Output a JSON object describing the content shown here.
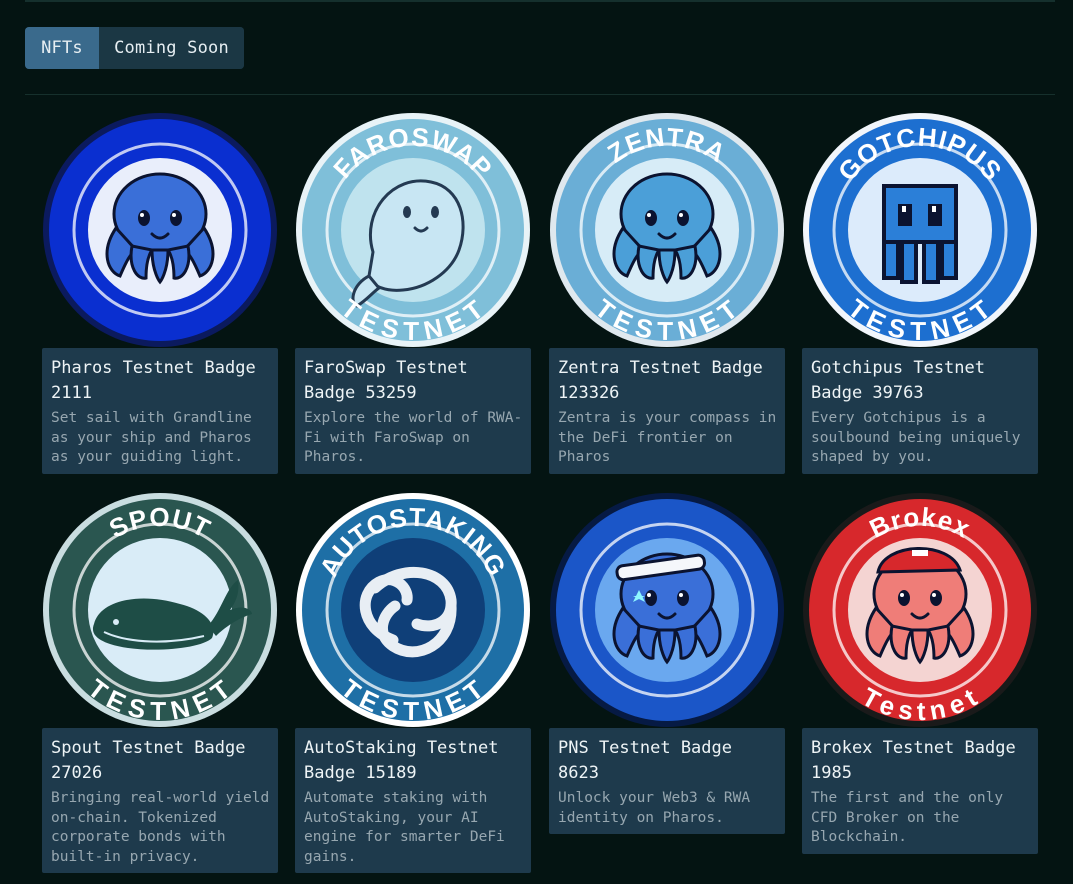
{
  "tabs": [
    {
      "label": "NFTs",
      "active": true
    },
    {
      "label": "Coming Soon",
      "active": false
    }
  ],
  "nfts": [
    {
      "title": "Pharos Testnet Badge 2111",
      "description": "Set sail with Grandline as your ship and Pharos as your guiding light.",
      "badge_text_top": "",
      "badge_text_bottom": "",
      "icon": "octopus-icon",
      "palette": {
        "bg": "#0a2fd0",
        "inner": "#e9eefb",
        "body": "#3a6fd8",
        "rim": "#0b1a5e"
      }
    },
    {
      "title": "FaroSwap Testnet Badge 53259",
      "description": "Explore the world of RWA-Fi with FaroSwap on Pharos.",
      "badge_text_top": "FAROSWAP",
      "badge_text_bottom": "TESTNET",
      "icon": "dolphin-icon",
      "palette": {
        "bg": "#7fbfd9",
        "inner": "#bfe3ee",
        "body": "#c8e6f3",
        "rim": "#e8f3f7"
      }
    },
    {
      "title": "Zentra Testnet Badge 123326",
      "description": "Zentra is your compass in the DeFi frontier on Pharos",
      "badge_text_top": "ZENTRA",
      "badge_text_bottom": "TESTNET",
      "icon": "octopus-icon",
      "palette": {
        "bg": "#6aaed6",
        "inner": "#d7ecf7",
        "body": "#4b9fd8",
        "rim": "#dfe8ee"
      }
    },
    {
      "title": "Gotchipus Testnet Badge 39763",
      "description": "Every Gotchipus is a soulbound being uniquely shaped by you.",
      "badge_text_top": "GOTCHIPUS",
      "badge_text_bottom": "TESTNET",
      "icon": "pixel-octopus-icon",
      "palette": {
        "bg": "#1d6fd0",
        "inner": "#dcebfb",
        "body": "#2b7fd8",
        "rim": "#f2f6fb"
      }
    },
    {
      "title": "Spout Testnet Badge 27026",
      "description": "Bringing real-world yield on-chain. Tokenized corporate bonds with built-in privacy.",
      "badge_text_top": "SPOUT",
      "badge_text_bottom": "TESTNET",
      "icon": "whale-icon",
      "palette": {
        "bg": "#2a5650",
        "inner": "#d9ecf7",
        "body": "#1e4d46",
        "rim": "#c9dde0"
      }
    },
    {
      "title": "AutoStaking Testnet Badge 15189",
      "description": "Automate staking with AutoStaking, your AI engine for smarter DeFi gains.",
      "badge_text_top": "AUTOSTAKING",
      "badge_text_bottom": "TESTNET",
      "icon": "knot-icon",
      "palette": {
        "bg": "#1e6fa6",
        "inner": "#0f3f78",
        "body": "#e8eef4",
        "rim": "#ffffff"
      }
    },
    {
      "title": "PNS Testnet Badge 8623",
      "description": "Unlock your Web3 & RWA identity on Pharos.",
      "badge_text_top": "",
      "badge_text_bottom": "",
      "icon": "octopus-icon",
      "palette": {
        "bg": "#1b56c8",
        "inner": "#6aa8ef",
        "body": "#3a6fd8",
        "rim": "#061a44"
      }
    },
    {
      "title": "Brokex Testnet Badge 1985",
      "description": "The first and the only CFD Broker on the Blockchain.",
      "badge_text_top": "Brokex",
      "badge_text_bottom": "Testnet",
      "icon": "octopus-icon",
      "palette": {
        "bg": "#d7282c",
        "inner": "#f4d4d2",
        "body": "#ef7d78",
        "rim": "#1a1a1a"
      }
    }
  ]
}
